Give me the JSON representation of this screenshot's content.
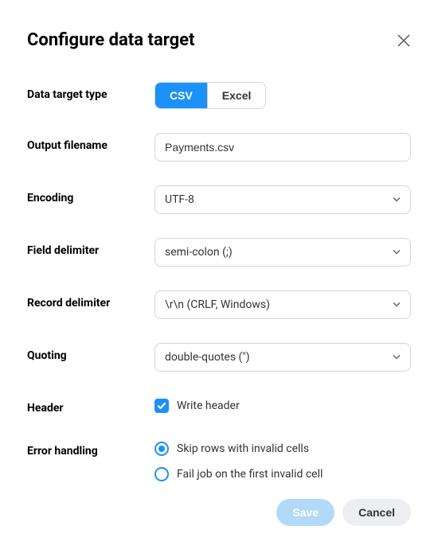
{
  "title": "Configure data target",
  "labels": {
    "data_target_type": "Data target type",
    "output_filename": "Output filename",
    "encoding": "Encoding",
    "field_delimiter": "Field delimiter",
    "record_delimiter": "Record delimiter",
    "quoting": "Quoting",
    "header": "Header",
    "error_handling": "Error handling"
  },
  "toggle": {
    "csv": "CSV",
    "excel": "Excel"
  },
  "values": {
    "output_filename": "Payments.csv",
    "encoding": "UTF-8",
    "field_delimiter": "semi-colon (;)",
    "record_delimiter": "\\r\\n (CRLF, Windows)",
    "quoting": "double-quotes (\")"
  },
  "header_checkbox": "Write header",
  "error_options": {
    "skip": "Skip rows with invalid cells",
    "fail": "Fail job on the first invalid cell"
  },
  "buttons": {
    "save": "Save",
    "cancel": "Cancel"
  }
}
